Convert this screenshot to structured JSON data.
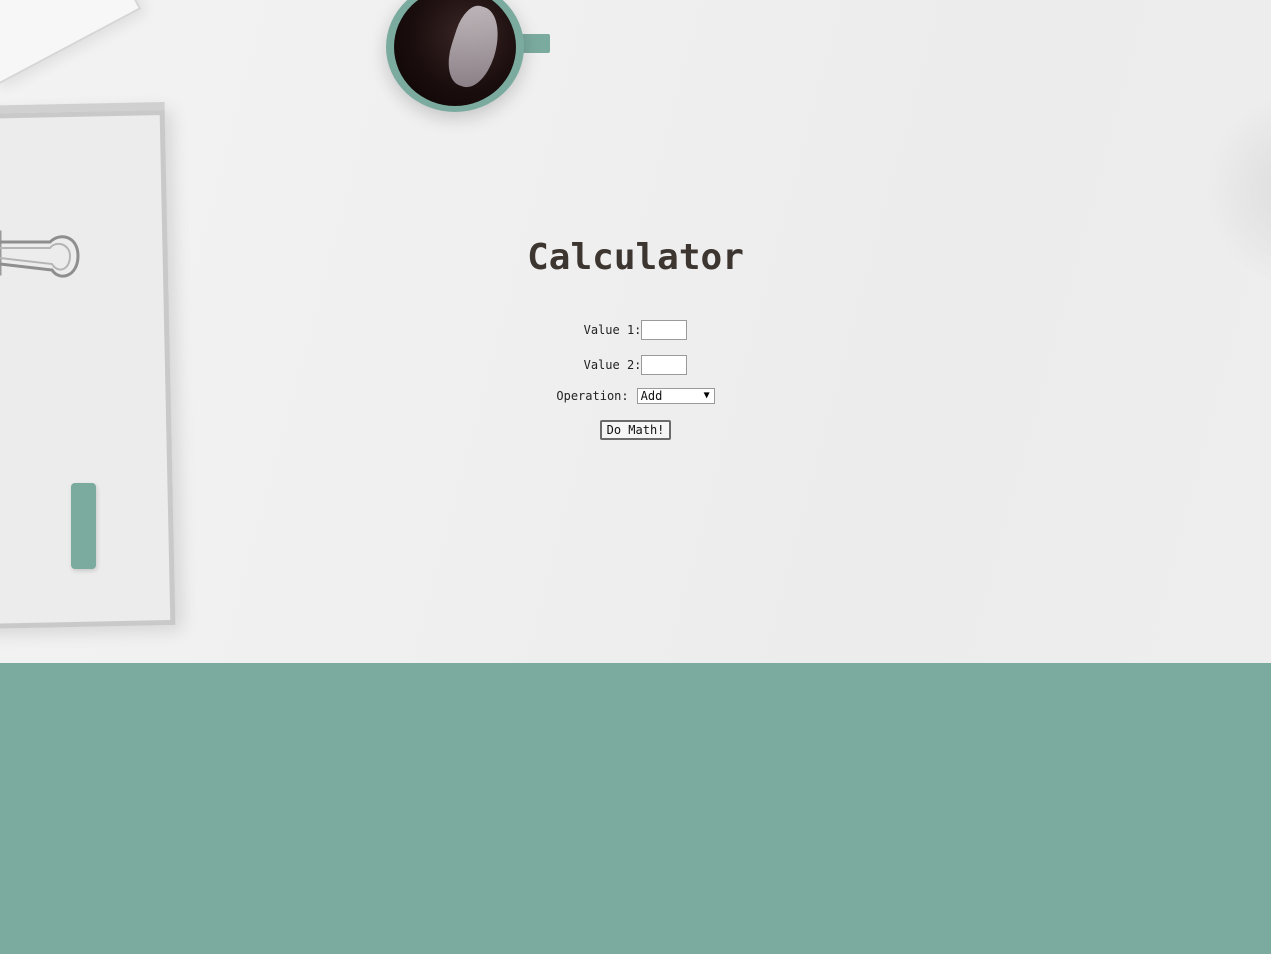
{
  "page": {
    "title": "Calculator"
  },
  "form": {
    "value1_label": "Value 1:",
    "value1_value": "",
    "value2_label": "Value 2:",
    "value2_value": "",
    "operation_label": "Operation:",
    "operation_selected": "Add",
    "submit_label": "Do Math!"
  },
  "theme": {
    "accent": "#7bab9f",
    "title_color": "#3d3530",
    "background": "#efefef"
  },
  "icons": {
    "select_arrow": "dropdown-arrow-icon"
  }
}
